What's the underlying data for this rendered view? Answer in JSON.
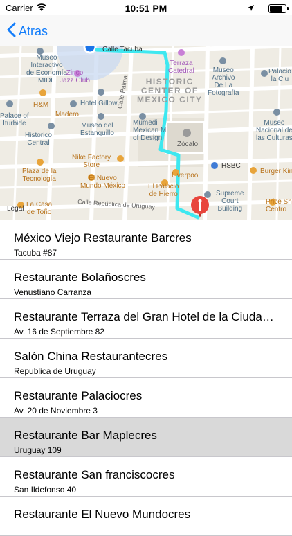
{
  "status_bar": {
    "carrier": "Carrier",
    "time": "10:51 PM"
  },
  "navbar": {
    "back_label": "Atras"
  },
  "map": {
    "labels": {
      "calle_tacuba": "Calle Tacuba",
      "museo_mide": "Museo\nInteractivo\nde Economía\nMIDE",
      "zinco": "Zinco\nJazz Club",
      "terraza": "Terraza\nCatedral",
      "museo_archivo": "Museo\nArchivo\nDe La\nFotografía",
      "palacio": "Palacio\nla Ciu",
      "historic": "HISTORIC\nCENTER OF\nMEXICO CITY",
      "hm": "H&M",
      "hotel_gillow": "Hotel Gillow",
      "palace_iturbide": "Palace of\nIturbide",
      "madero": "Madero",
      "museo_estanquillo": "Museo del\nEstanquillo",
      "calle_palma": "Calle Palma",
      "mumedi": "Mumedi\nMexican M\nof Design",
      "zocalo": "Zócalo",
      "museo_nacional": "Museo\nNacional de\nlas Culturas",
      "historico": "Historico\nCentral",
      "nike": "Nike Factory\nStore",
      "hsbc": "HSBC",
      "burger_king": "Burger Kin",
      "liverpool": "Liverpool",
      "plaza_tecnologia": "Plaza de la\nTecnología",
      "el_nuevo_mundo": "El Nuevo\nMundo México",
      "el_palacio": "El Palacio\nde Hierro",
      "supreme": "Supreme\nCourt\nBuilding",
      "price_shoes": "Price Sh\nCentro",
      "la_casa": "La Casa\nde Toño",
      "calle_uruguay": "Calle República de Uruguay",
      "legal": "Legal"
    }
  },
  "restaurants": [
    {
      "name": "México Viejo Restaurante Barcres",
      "address": "Tacuba #87",
      "selected": false
    },
    {
      "name": "Restaurante Bolañoscres",
      "address": "Venustiano Carranza",
      "selected": false
    },
    {
      "name": "Restaurante Terraza del Gran Hotel de la Ciudad de México",
      "address": "Av. 16 de Septiembre 82",
      "selected": false
    },
    {
      "name": "Salón China Restaurantecres",
      "address": "Republica de Uruguay",
      "selected": false
    },
    {
      "name": "Restaurante Palaciocres",
      "address": "Av. 20 de Noviembre 3",
      "selected": false
    },
    {
      "name": "Restaurante Bar Maplecres",
      "address": "Uruguay 109",
      "selected": true
    },
    {
      "name": "Restaurante San franciscocres",
      "address": "San Ildefonso 40",
      "selected": false
    },
    {
      "name": "Restaurante El Nuevo Mundocres",
      "address": "",
      "selected": false
    }
  ],
  "colors": {
    "accent": "#147efb",
    "route": "#3ee8f0",
    "pin": "#e8453c",
    "selected_row": "#d9d9d9"
  }
}
